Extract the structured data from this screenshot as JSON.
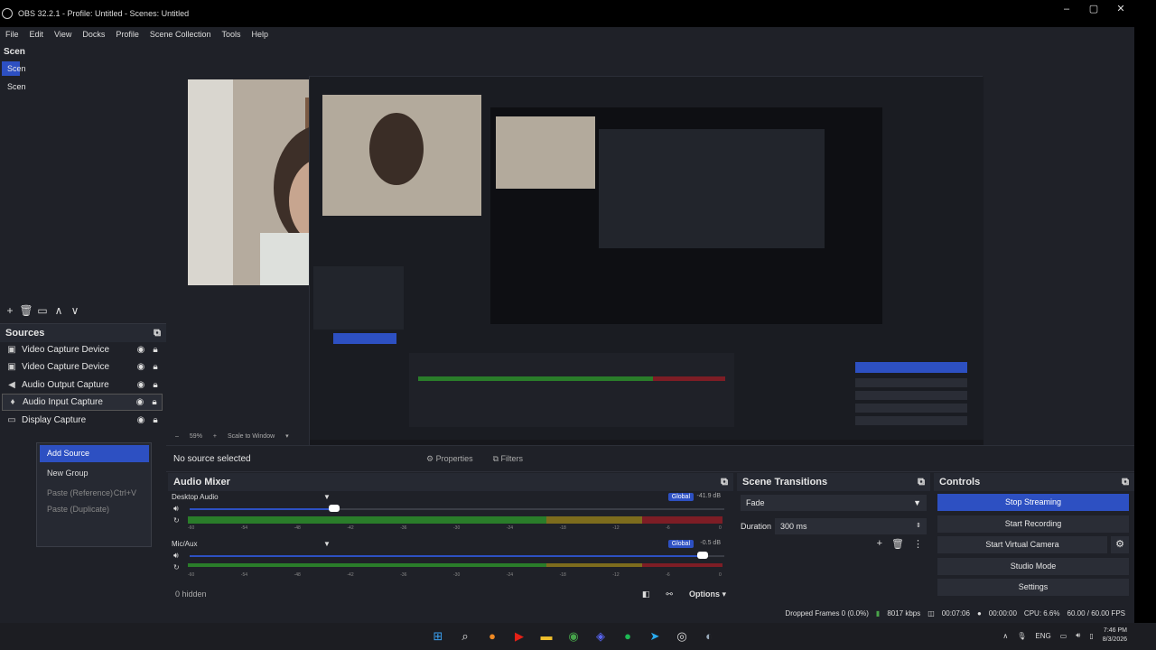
{
  "window": {
    "title": "OBS 32.2.1 - Profile: Untitled - Scenes: Untitled",
    "minimize": "–",
    "maximize": "▢",
    "close": "✕"
  },
  "menu": [
    "File",
    "Edit",
    "View",
    "Docks",
    "Profile",
    "Scene Collection",
    "Tools",
    "Help"
  ],
  "scenes": {
    "title": "Scen",
    "items": [
      "Scen",
      "Scen"
    ]
  },
  "scenes_toolbar": [
    "+",
    "🗑",
    "▭",
    "∧",
    "∨"
  ],
  "sources": {
    "title": "Sources",
    "items": [
      {
        "label": "Video Capture Device",
        "icon": "camera-icon"
      },
      {
        "label": "Video Capture Device",
        "icon": "camera-icon"
      },
      {
        "label": "Audio Output Capture",
        "icon": "speaker-icon"
      },
      {
        "label": "Audio Input Capture",
        "icon": "mic-icon"
      },
      {
        "label": "Display Capture",
        "icon": "monitor-icon"
      }
    ]
  },
  "context_menu": {
    "add_source": "Add Source",
    "new_group": "New Group",
    "paste_reference": "Paste (Reference)",
    "paste_reference_shortcut": "Ctrl+V",
    "paste_duplicate": "Paste (Duplicate)"
  },
  "sources_toolbar": [
    "+",
    "🗑",
    "⚙",
    "∧",
    "∨"
  ],
  "preview": {
    "scale_pct": "59%",
    "scale_mode": "Scale to Window"
  },
  "context_bar": {
    "no_selection": "No source selected",
    "properties": "Properties",
    "filters": "Filters"
  },
  "audio_mixer": {
    "title": "Audio Mixer",
    "tracks": [
      {
        "name": "Desktop Audio",
        "db": "-41.9 dB",
        "global": "Global",
        "volume": 0.27
      },
      {
        "name": "Mic/Aux",
        "db": "-0.5 dB",
        "global": "Global",
        "volume": 0.96
      }
    ],
    "meter_ticks": [
      "-60",
      "-54",
      "-48",
      "-42",
      "-36",
      "-30",
      "-24",
      "-18",
      "-12",
      "-6",
      "0"
    ],
    "hidden": "0 hidden",
    "options": "Options"
  },
  "scene_transitions": {
    "title": "Scene Transitions",
    "transition": "Fade",
    "duration_label": "Duration",
    "duration_value": "300 ms"
  },
  "controls": {
    "title": "Controls",
    "stop_streaming": "Stop Streaming",
    "start_recording": "Start Recording",
    "start_virtual_camera": "Start Virtual Camera",
    "studio_mode": "Studio Mode",
    "settings": "Settings"
  },
  "status": {
    "dropped_frames": "Dropped Frames 0 (0.0%)",
    "kbps": "8017 kbps",
    "stream_time": "00:07:06",
    "rec_time": "00:00:00",
    "cpu": "CPU: 6.6%",
    "fps": "60.00 / 60.00 FPS"
  },
  "taskbar": {
    "lang": "ENG",
    "time": "7:46 PM",
    "date": "8/3/2026"
  },
  "colors": {
    "accent": "#2d50c2",
    "panel": "#1f2128",
    "meter_green": "#2a7d2a",
    "meter_yellow": "#7d6c1d",
    "meter_red": "#7d1d25"
  }
}
